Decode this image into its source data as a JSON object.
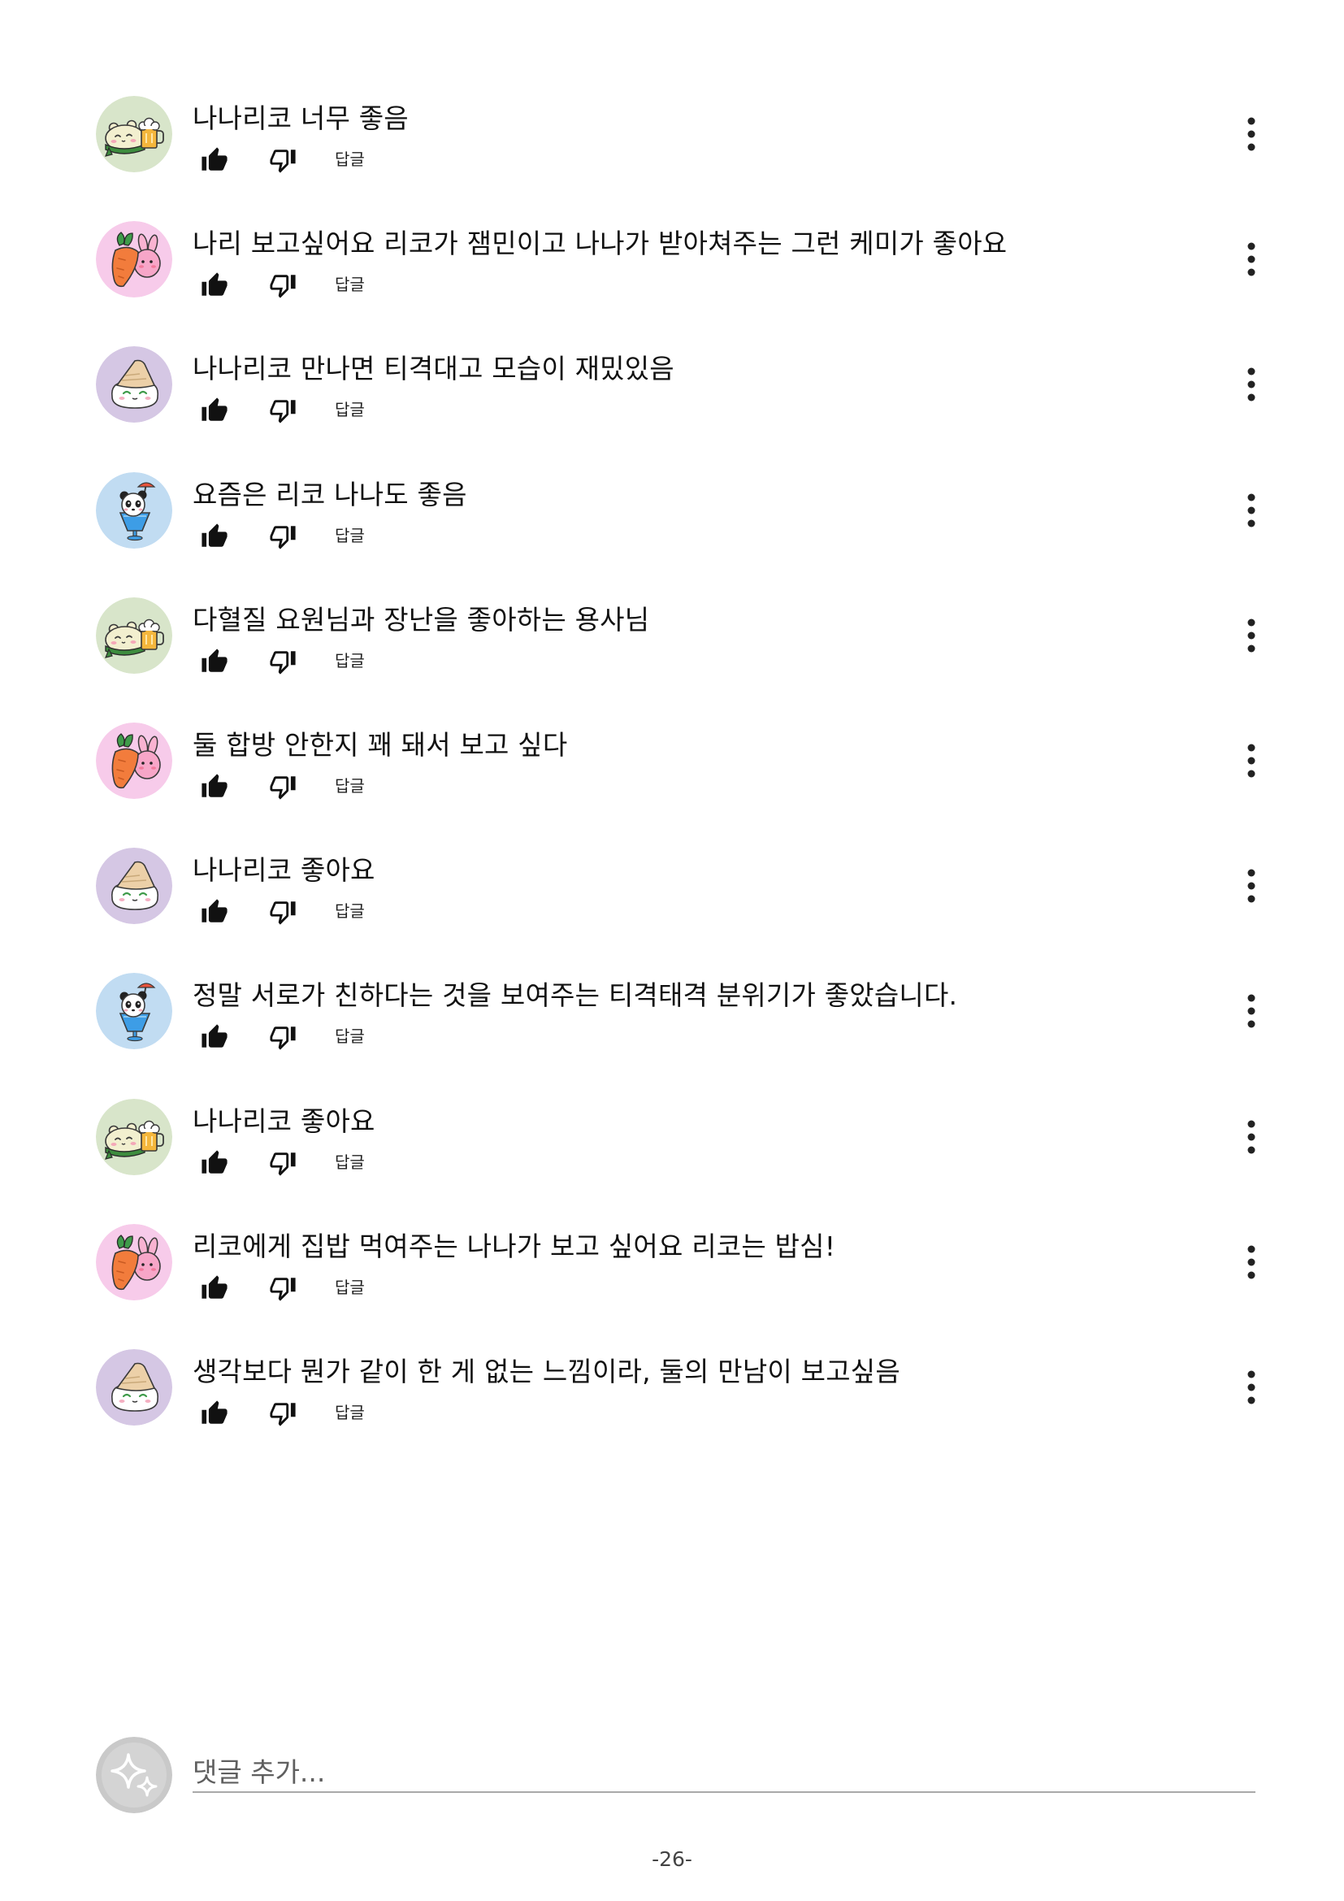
{
  "comments": [
    {
      "text": "나나리코 너무 좋음",
      "avatar": "hamster-beer-avatar",
      "avatar_color": "#d8e5ca"
    },
    {
      "text": "나리 보고싶어요 리코가 잼민이고 나나가 받아쳐주는 그런 케미가 좋아요",
      "avatar": "carrot-bunny-avatar",
      "avatar_color": "#f7cbea"
    },
    {
      "text": "나나리코 만나면 티격대고 모습이 재밌있음",
      "avatar": "riceball-avatar",
      "avatar_color": "#d5c7e4"
    },
    {
      "text": "요즘은 리코 나나도 좋음",
      "avatar": "panda-drink-avatar",
      "avatar_color": "#c1dcf2"
    },
    {
      "text": "다혈질 요원님과 장난을 좋아하는 용사님",
      "avatar": "hamster-beer-avatar",
      "avatar_color": "#d8e5ca"
    },
    {
      "text": "둘 합방 안한지 꽤 돼서 보고 싶다",
      "avatar": "carrot-bunny-avatar",
      "avatar_color": "#f7cbea"
    },
    {
      "text": "나나리코 좋아요",
      "avatar": "riceball-avatar",
      "avatar_color": "#d5c7e4"
    },
    {
      "text": "정말 서로가 친하다는 것을 보여주는 티격태격 분위기가 좋았습니다.",
      "avatar": "panda-drink-avatar",
      "avatar_color": "#c1dcf2"
    },
    {
      "text": "나나리코 좋아요",
      "avatar": "hamster-beer-avatar",
      "avatar_color": "#d8e5ca"
    },
    {
      "text": "리코에게 집밥 먹여주는 나나가 보고 싶어요 리코는 밥심!",
      "avatar": "carrot-bunny-avatar",
      "avatar_color": "#f7cbea"
    },
    {
      "text": "생각보다 뭔가 같이 한 게 없는 느낌이라, 둘의 만남이 보고싶음",
      "avatar": "riceball-avatar",
      "avatar_color": "#d5c7e4"
    }
  ],
  "comment_actions": {
    "like_icon": "thumbs-up-icon",
    "dislike_icon": "thumbs-down-icon",
    "reply_label": "답글",
    "more_icon": "more-vert-icon"
  },
  "composer": {
    "placeholder": "댓글 추가...",
    "avatar": "sparkle-avatar",
    "avatar_color": "#c9c9c9"
  },
  "page_number": "-26-"
}
